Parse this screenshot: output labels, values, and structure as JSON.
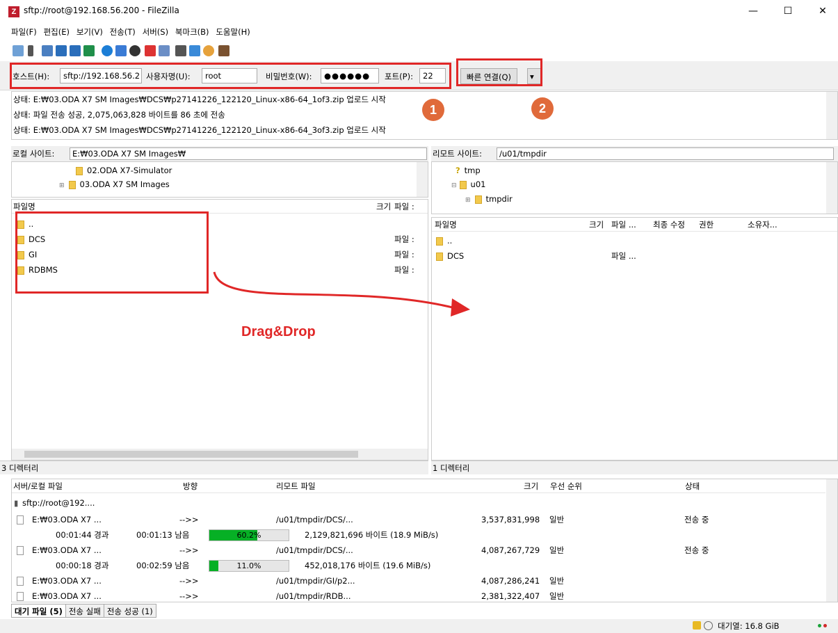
{
  "window": {
    "title": "sftp://root@192.168.56.200 - FileZilla",
    "app_icon": "Z",
    "minimize": "—",
    "maximize": "☐",
    "close": "✕"
  },
  "menu": [
    "파일(F)",
    "편집(E)",
    "보기(V)",
    "전송(T)",
    "서버(S)",
    "북마크(B)",
    "도움말(H)"
  ],
  "quickconnect": {
    "host_label": "호스트(H):",
    "host_value": "sftp://192.168.56.2",
    "user_label": "사용자명(U):",
    "user_value": "root",
    "pass_label": "비밀번호(W):",
    "pass_value": "●●●●●●",
    "port_label": "포트(P):",
    "port_value": "22",
    "connect_button": "빠른 연결(Q)",
    "dropdown": "▾"
  },
  "annotations": {
    "badge1": "1",
    "badge2": "2",
    "drag_label": "Drag&Drop"
  },
  "log": [
    "상태:  E:₩03.ODA X7 SM Images₩DCS₩p27141226_122120_Linux-x86-64_1of3.zip 업로드 시작",
    "상태:  파일 전송 성공, 2,075,063,828 바이트를 86 초에 전송",
    "상태:  E:₩03.ODA X7 SM Images₩DCS₩p27141226_122120_Linux-x86-64_3of3.zip 업로드 시작"
  ],
  "local": {
    "site_label": "로컬 사이트:",
    "site_path": "E:₩03.ODA X7 SM Images₩",
    "tree": [
      "02.ODA X7-Simulator",
      "03.ODA X7 SM Images"
    ],
    "col_name": "파일명",
    "col_size": "크기",
    "col_type": "파일 :",
    "files": [
      {
        "name": "..",
        "type": ""
      },
      {
        "name": "DCS",
        "type": "파일 :"
      },
      {
        "name": "GI",
        "type": "파일 :"
      },
      {
        "name": "RDBMS",
        "type": "파일 :"
      }
    ],
    "status": "3 디렉터리"
  },
  "remote": {
    "site_label": "리모트 사이트:",
    "site_path": "/u01/tmpdir",
    "tree": [
      "tmp",
      "u01",
      "tmpdir"
    ],
    "col_name": "파일명",
    "col_size": "크기",
    "col_type": "파일 ...",
    "col_modified": "최종 수정",
    "col_perm": "권한",
    "col_owner": "소유자...",
    "files": [
      {
        "name": "..",
        "type": ""
      },
      {
        "name": "DCS",
        "type": "파일 ..."
      }
    ],
    "status": "1 디렉터리"
  },
  "queue": {
    "headers": {
      "local": "서버/로컬 파일",
      "direction": "방향",
      "remote": "리모트 파일",
      "size": "크기",
      "priority": "우선 순위",
      "status": "상태"
    },
    "server": "sftp://root@192....",
    "rows": [
      {
        "local": "E:₩03.ODA X7 ...",
        "dir": "-->>",
        "remote": "/u01/tmpdir/DCS/...",
        "size": "3,537,831,998",
        "prio": "일반",
        "status": "전송 중",
        "elapsed": "00:01:44 경과",
        "left": "00:01:13 남음",
        "progress": 0.602,
        "progress_text": "60.2%",
        "bytes": "2,129,821,696 바이트 (18.9 MiB/s)"
      },
      {
        "local": "E:₩03.ODA X7 ...",
        "dir": "-->>",
        "remote": "/u01/tmpdir/DCS/...",
        "size": "4,087,267,729",
        "prio": "일반",
        "status": "전송 중",
        "elapsed": "00:00:18 경과",
        "left": "00:02:59 남음",
        "progress": 0.11,
        "progress_text": "11.0%",
        "bytes": "452,018,176 바이트 (19.6 MiB/s)"
      },
      {
        "local": "E:₩03.ODA X7 ...",
        "dir": "-->>",
        "remote": "/u01/tmpdir/GI/p2...",
        "size": "4,087,286,241",
        "prio": "일반",
        "status": ""
      },
      {
        "local": "E:₩03.ODA X7 ...",
        "dir": "-->>",
        "remote": "/u01/tmpdir/RDB...",
        "size": "2,381,322,407",
        "prio": "일반",
        "status": ""
      }
    ]
  },
  "tabs": [
    "대기 파일 (5)",
    "전송 실패",
    "전송 성공 (1)"
  ],
  "statusbar": {
    "queue_text": "대기열: 16.8 GiB"
  }
}
